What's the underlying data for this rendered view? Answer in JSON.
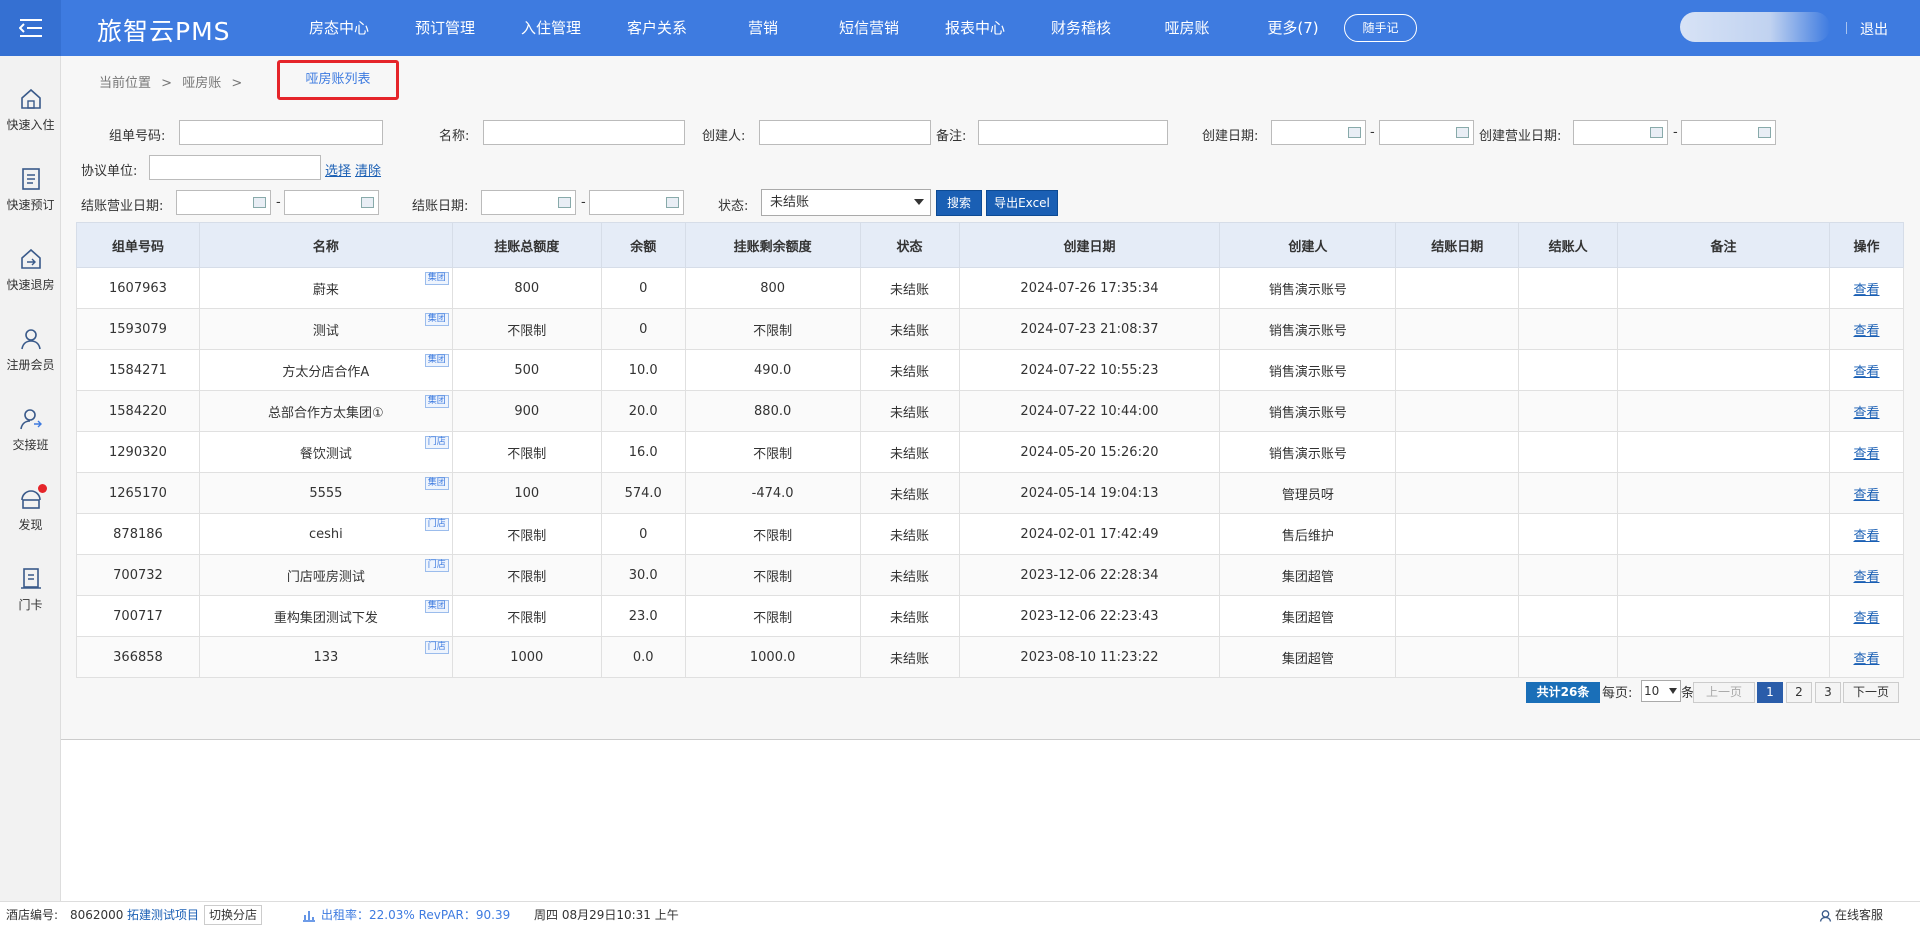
{
  "header": {
    "brand": "旅智云PMS",
    "nav": [
      "房态中心",
      "预订管理",
      "入住管理",
      "客户关系",
      "营销",
      "短信营销",
      "报表中心",
      "财务稽核",
      "哑房账",
      "更多(7)"
    ],
    "note_button": "随手记",
    "logout": "退出"
  },
  "sidebar": [
    {
      "label": "快速入住",
      "icon": "home-icon"
    },
    {
      "label": "快速预订",
      "icon": "document-icon"
    },
    {
      "label": "快速退房",
      "icon": "checkout-icon"
    },
    {
      "label": "注册会员",
      "icon": "user-icon"
    },
    {
      "label": "交接班",
      "icon": "shift-icon"
    },
    {
      "label": "发现",
      "icon": "discover-icon"
    },
    {
      "label": "门卡",
      "icon": "card-icon"
    }
  ],
  "breadcrumb": {
    "prefix": "当前位置",
    "sep": ">",
    "item": "哑房账"
  },
  "subtab": "哑房账列表",
  "filters": {
    "group_no": "组单号码:",
    "name": "名称:",
    "creator": "创建人:",
    "remark": "备注:",
    "create_date": "创建日期:",
    "create_biz_date": "创建营业日期:",
    "agreement_unit": "协议单位:",
    "select_link": "选择",
    "clear_link": "清除",
    "checkout_biz_date": "结账营业日期:",
    "checkout_date": "结账日期:",
    "status": "状态:",
    "status_value": "未结账",
    "dash": "-",
    "search_button": "搜索",
    "export_button": "导出Excel"
  },
  "table": {
    "headers": [
      "组单号码",
      "名称",
      "挂账总额度",
      "余额",
      "挂账剩余额度",
      "状态",
      "创建日期",
      "创建人",
      "结账日期",
      "结账人",
      "备注",
      "操作"
    ],
    "rows": [
      {
        "no": "1607963",
        "name": "蔚来",
        "tag": "集团",
        "total": "800",
        "balance": "0",
        "remain": "800",
        "status": "未结账",
        "created": "2024-07-26 17:35:34",
        "creator": "销售演示账号",
        "action": "查看"
      },
      {
        "no": "1593079",
        "name": "测试",
        "tag": "集团",
        "total": "不限制",
        "balance": "0",
        "remain": "不限制",
        "status": "未结账",
        "created": "2024-07-23 21:08:37",
        "creator": "销售演示账号",
        "action": "查看"
      },
      {
        "no": "1584271",
        "name": "方太分店合作A",
        "tag": "集团",
        "total": "500",
        "balance": "10.0",
        "remain": "490.0",
        "status": "未结账",
        "created": "2024-07-22 10:55:23",
        "creator": "销售演示账号",
        "action": "查看"
      },
      {
        "no": "1584220",
        "name": "总部合作方太集团①",
        "tag": "集团",
        "total": "900",
        "balance": "20.0",
        "remain": "880.0",
        "status": "未结账",
        "created": "2024-07-22 10:44:00",
        "creator": "销售演示账号",
        "action": "查看"
      },
      {
        "no": "1290320",
        "name": "餐饮测试",
        "tag": "门店",
        "total": "不限制",
        "balance": "16.0",
        "remain": "不限制",
        "status": "未结账",
        "created": "2024-05-20 15:26:20",
        "creator": "销售演示账号",
        "action": "查看"
      },
      {
        "no": "1265170",
        "name": "5555",
        "tag": "集团",
        "total": "100",
        "balance": "574.0",
        "remain": "-474.0",
        "status": "未结账",
        "created": "2024-05-14 19:04:13",
        "creator": "管理员呀",
        "action": "查看"
      },
      {
        "no": "878186",
        "name": "ceshi",
        "tag": "门店",
        "total": "不限制",
        "balance": "0",
        "remain": "不限制",
        "status": "未结账",
        "created": "2024-02-01 17:42:49",
        "creator": "售后维护",
        "action": "查看"
      },
      {
        "no": "700732",
        "name": "门店哑房测试",
        "tag": "门店",
        "total": "不限制",
        "balance": "30.0",
        "remain": "不限制",
        "status": "未结账",
        "created": "2023-12-06 22:28:34",
        "creator": "集团超管",
        "action": "查看"
      },
      {
        "no": "700717",
        "name": "重构集团测试下发",
        "tag": "集团",
        "total": "不限制",
        "balance": "23.0",
        "remain": "不限制",
        "status": "未结账",
        "created": "2023-12-06 22:23:43",
        "creator": "集团超管",
        "action": "查看"
      },
      {
        "no": "366858",
        "name": "133",
        "tag": "门店",
        "total": "1000",
        "balance": "0.0",
        "remain": "1000.0",
        "status": "未结账",
        "created": "2023-08-10 11:23:22",
        "creator": "集团超管",
        "action": "查看"
      }
    ]
  },
  "pagination": {
    "total": "共计26条",
    "per_page_label": "每页:",
    "per_page": "10",
    "unit": "条",
    "prev": "上一页",
    "pages": [
      "1",
      "2",
      "3"
    ],
    "next": "下一页"
  },
  "statusbar": {
    "hotel_no_label": "酒店编号:",
    "hotel_no": "8062000",
    "project": "拓建测试项目",
    "switch": "切换分店",
    "occupancy": "出租率：22.03% RevPAR：90.39",
    "datetime": "周四 08月29日10:31 上午",
    "service": "在线客服"
  }
}
